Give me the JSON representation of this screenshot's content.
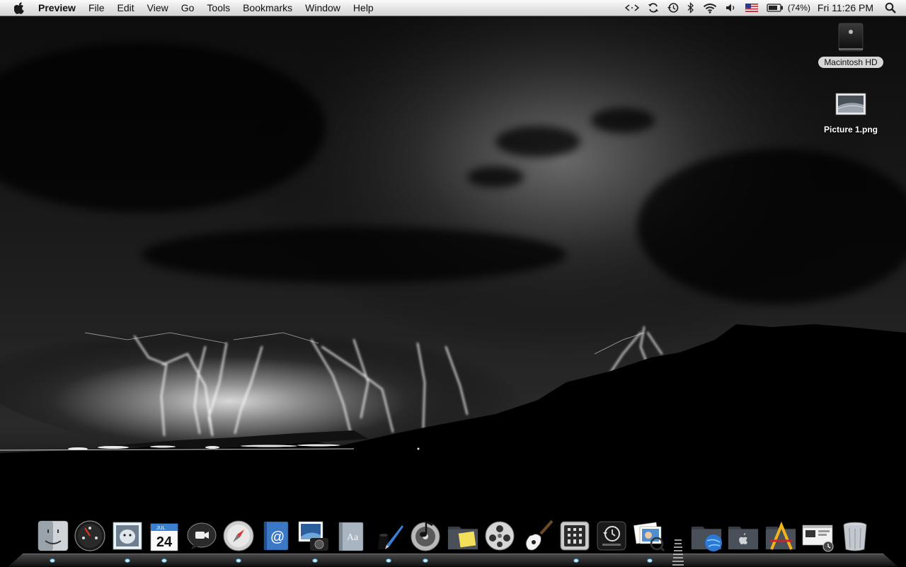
{
  "menubar": {
    "app_name": "Preview",
    "menus": [
      "File",
      "Edit",
      "View",
      "Go",
      "Tools",
      "Bookmarks",
      "Window",
      "Help"
    ],
    "status": {
      "screen_sharing": "<·>",
      "battery_percent": "(74%)",
      "clock": "Fri 11:26 PM"
    }
  },
  "desktop": {
    "icons": [
      {
        "label": "Macintosh HD"
      },
      {
        "label": "Picture 1.png"
      }
    ]
  },
  "dock": {
    "items": [
      {
        "name": "finder-icon"
      },
      {
        "name": "dashboard-icon"
      },
      {
        "name": "mail-icon"
      },
      {
        "name": "ical-icon",
        "date": "24",
        "month": "JUL"
      },
      {
        "name": "ichat-icon"
      },
      {
        "name": "safari-icon"
      },
      {
        "name": "address-book-icon"
      },
      {
        "name": "iphoto-icon"
      },
      {
        "name": "dictionary-icon"
      },
      {
        "name": "textedit-icon"
      },
      {
        "name": "itunes-icon"
      },
      {
        "name": "stickies-folder-icon"
      },
      {
        "name": "dvd-player-icon"
      },
      {
        "name": "garageband-icon"
      },
      {
        "name": "system-preferences-icon"
      },
      {
        "name": "time-machine-icon"
      },
      {
        "name": "preview-icon"
      },
      {
        "name": "downloads-stack-icon"
      },
      {
        "name": "applications-stack-icon"
      },
      {
        "name": "xcode-stack-icon"
      },
      {
        "name": "screenshot-stack-icon"
      },
      {
        "name": "trash-icon"
      }
    ]
  },
  "colors": {
    "menubar_top": "#fbfbfb",
    "menubar_bottom": "#d4d4d4",
    "wallpaper_dark": "#0a0a0a",
    "lightning": "#ffffff",
    "running_indicator": "#7fd6ff"
  }
}
